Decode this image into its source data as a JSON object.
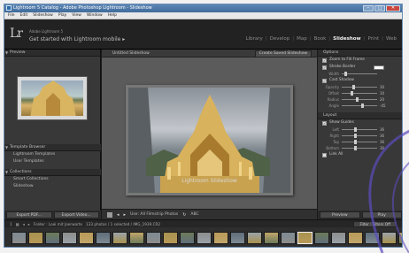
{
  "window": {
    "title": "Lightroom 5 Catalog - Adobe Photoshop Lightroom - Slideshow"
  },
  "menubar": [
    "File",
    "Edit",
    "Slideshow",
    "Play",
    "View",
    "Window",
    "Help"
  ],
  "identity": {
    "logo": "Lr",
    "line1": "Adobe Lightroom 5",
    "line2": "Get started with Lightroom mobile ▸"
  },
  "modules": [
    "Library",
    "Develop",
    "Map",
    "Book",
    "Slideshow",
    "Print",
    "Web"
  ],
  "active_module": "Slideshow",
  "left_panel": {
    "preview_header": "Preview",
    "template_header": "Template Browser",
    "templates": [
      "Lightroom Templates",
      "User Templates"
    ],
    "collections_header": "Collections",
    "collections": [
      "Smart Collections",
      "Slideshow"
    ],
    "buttons": [
      "Export PDF...",
      "Export Video..."
    ]
  },
  "center": {
    "title": "Untitled Slideshow",
    "create_button": "Create Saved Slideshow",
    "caption": "Lightroom Slideshow",
    "toolbar_label": "Use: All Filmstrip Photos",
    "toolbar_extra": "ABC"
  },
  "right_panel": {
    "options_header": "Options",
    "opt_zoom": "Zoom to Fill Frame",
    "opt_stroke": "Stroke Border",
    "width_label": "Width",
    "opt_shadow": "Cast Shadow",
    "shadow_rows": [
      {
        "label": "Opacity",
        "value": "30",
        "pos": 0.3
      },
      {
        "label": "Offset",
        "value": "10",
        "pos": 0.25
      },
      {
        "label": "Radius",
        "value": "20",
        "pos": 0.4
      },
      {
        "label": "Angle",
        "value": "-45",
        "pos": 0.55
      }
    ],
    "layout_header": "Layout",
    "opt_guides": "Show Guides",
    "layout_rows": [
      {
        "label": "Left",
        "value": "36",
        "pos": 0.35
      },
      {
        "label": "Right",
        "value": "36",
        "pos": 0.35
      },
      {
        "label": "Top",
        "value": "36",
        "pos": 0.35
      },
      {
        "label": "Bottom",
        "value": "36",
        "pos": 0.35
      }
    ],
    "link_all": "Link All",
    "buttons": [
      "Preview",
      "Play"
    ]
  },
  "filmstrip_bar": {
    "page": "1",
    "folder": "Folder : Loei mit Joerwarte",
    "count": "133 photos / 1 selected / IMG_1939.CR2",
    "filter_label": "Filter :",
    "filter_value": "Filters Off"
  },
  "filmstrip": {
    "thumb_count": 24
  }
}
